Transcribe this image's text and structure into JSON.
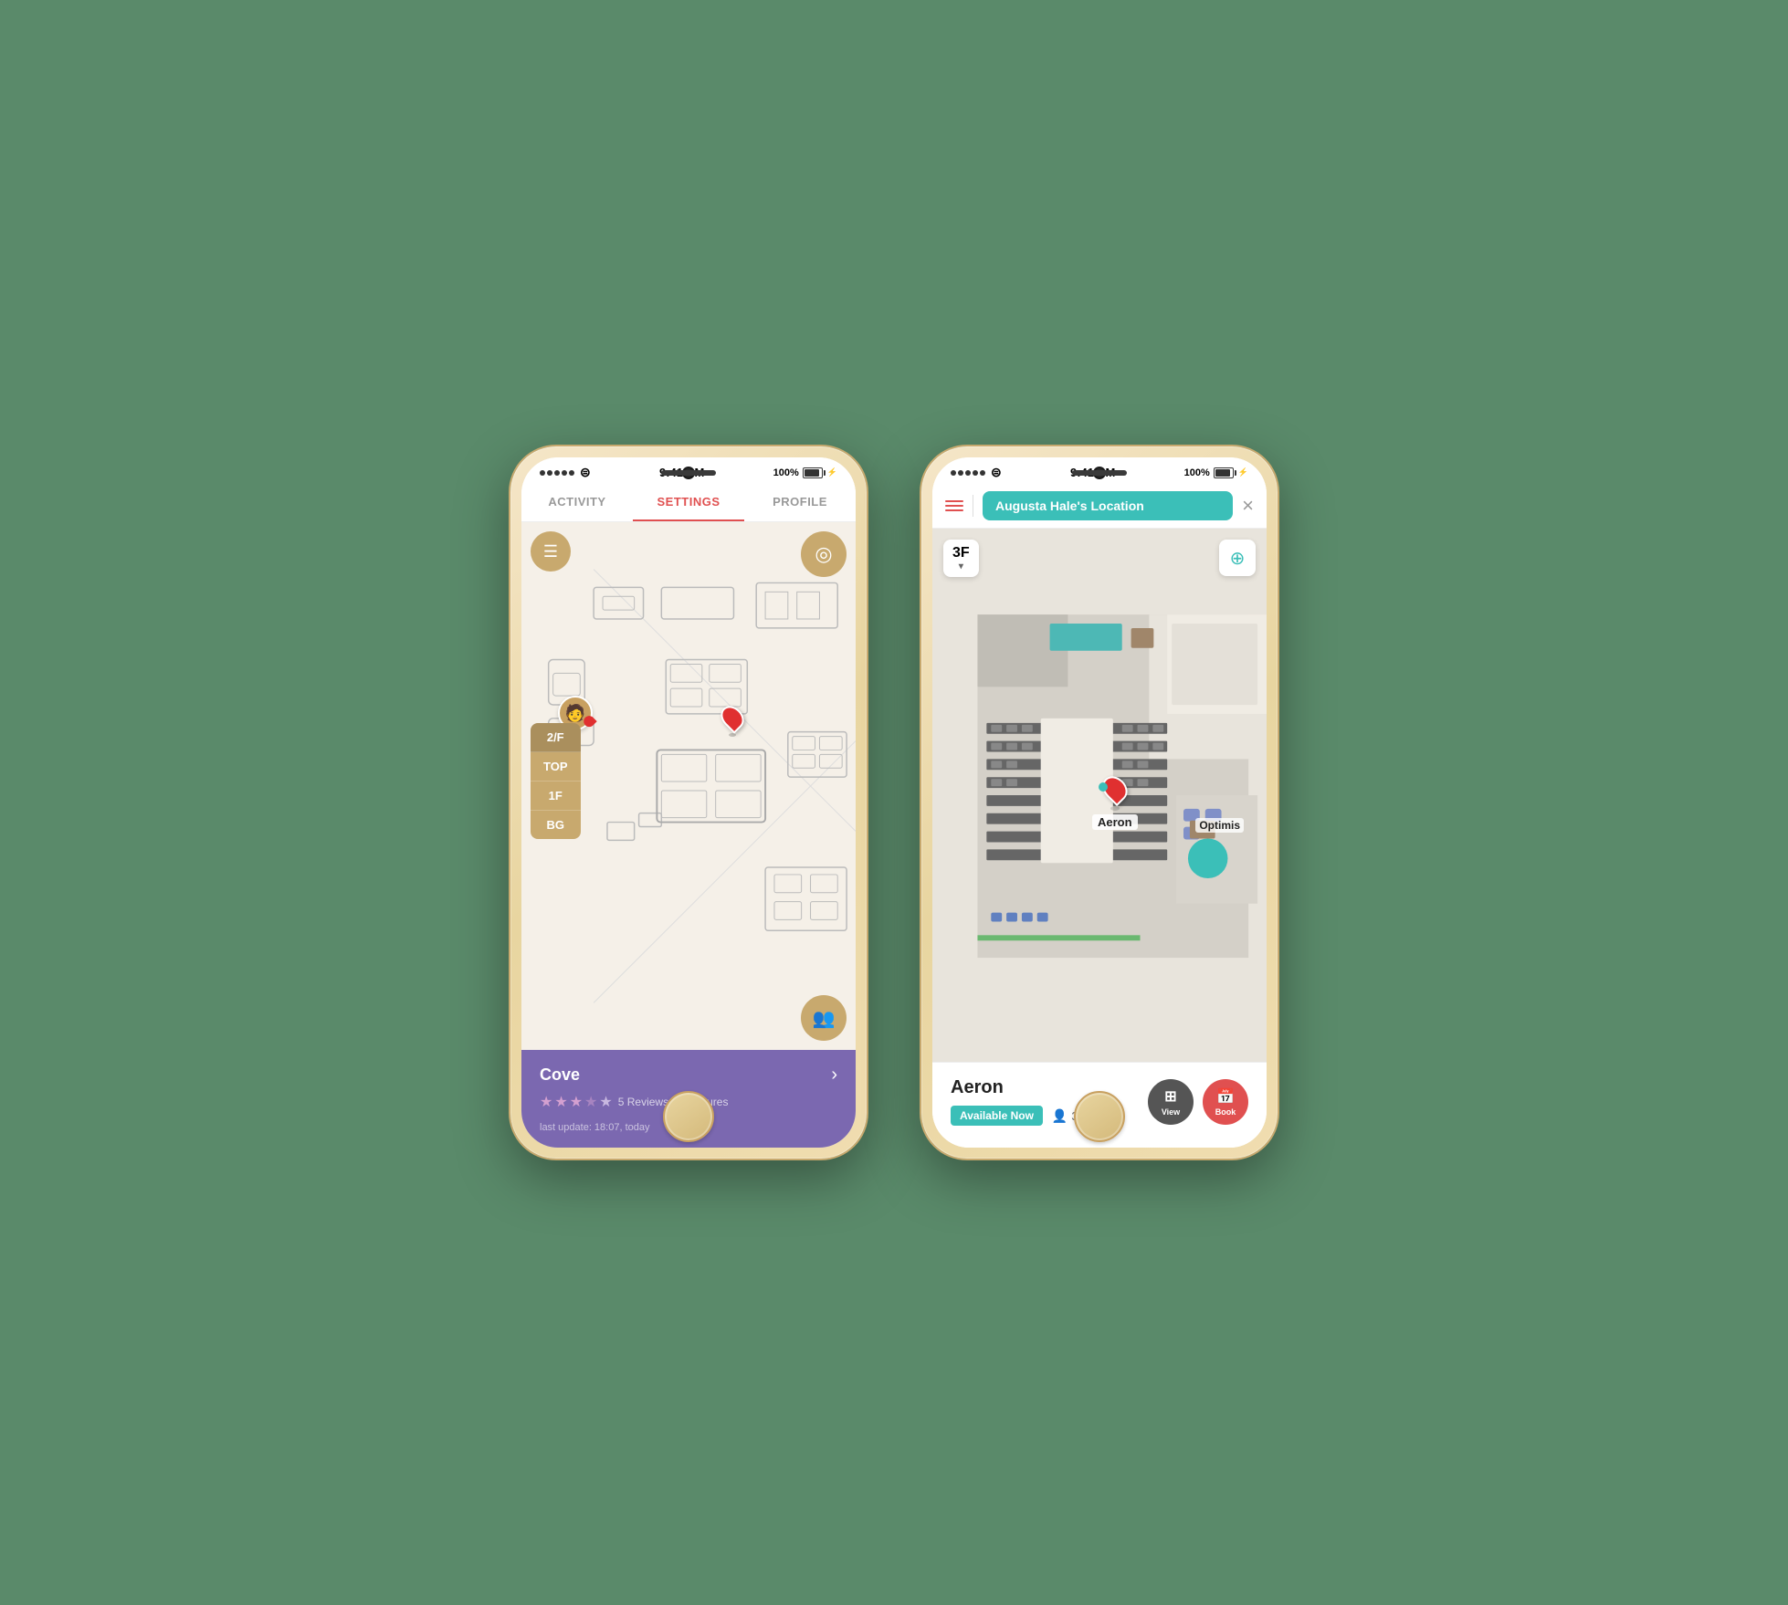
{
  "phone1": {
    "status_bar": {
      "signal": "•••••",
      "wifi": "wifi",
      "time": "9:41 AM",
      "battery_pct": "100%"
    },
    "nav_tabs": [
      {
        "id": "activity",
        "label": "ACTIVITY",
        "active": false
      },
      {
        "id": "settings",
        "label": "SETTINGS",
        "active": true
      },
      {
        "id": "profile",
        "label": "PROFILE",
        "active": false
      }
    ],
    "floor_buttons": [
      "2/F",
      "TOP",
      "1F",
      "BG"
    ],
    "active_floor": "2/F",
    "info_card": {
      "title": "Cove",
      "stars": 3.5,
      "reviews": "5 Reviews",
      "features": "0 Features",
      "last_update": "last update: 18:07, today"
    }
  },
  "phone2": {
    "status_bar": {
      "signal": "•••••",
      "wifi": "wifi",
      "time": "9:41 AM",
      "battery_pct": "100%"
    },
    "topbar": {
      "location_label": "Augusta Hale's Location"
    },
    "floor": "3F",
    "room_card": {
      "name": "Aeron",
      "status": "Available Now",
      "capacity": "3",
      "view_label": "View",
      "book_label": "Book"
    },
    "map_markers": [
      {
        "id": "aeron",
        "label": "Aeron",
        "type": "teal"
      },
      {
        "id": "optimis",
        "label": "Optimis",
        "type": "teal-circle"
      }
    ]
  }
}
